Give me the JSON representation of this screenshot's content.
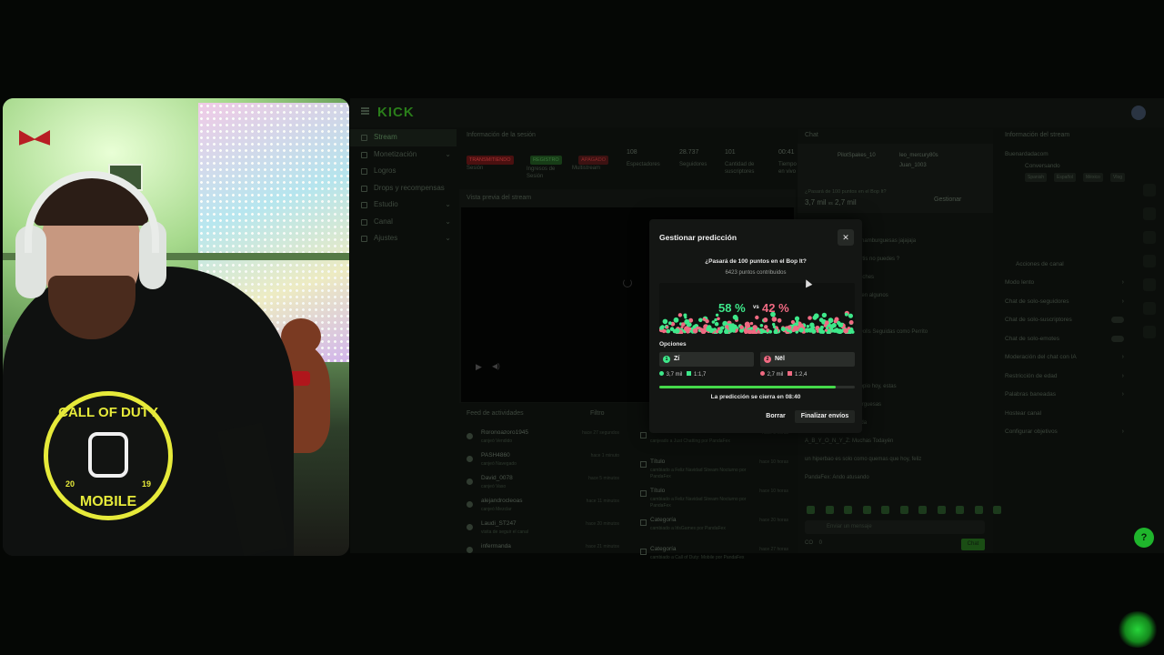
{
  "dashboard": {
    "logo": "KICK",
    "nav": [
      {
        "label": "Stream",
        "active": true,
        "chevron": false
      },
      {
        "label": "Monetización",
        "active": false,
        "chevron": true
      },
      {
        "label": "Logros",
        "active": false,
        "chevron": false
      },
      {
        "label": "Drops y recompensas",
        "active": false,
        "chevron": false
      },
      {
        "label": "Estudio",
        "active": false,
        "chevron": true
      },
      {
        "label": "Canal",
        "active": false,
        "chevron": true
      },
      {
        "label": "Ajustes",
        "active": false,
        "chevron": true
      }
    ],
    "session": {
      "title": "Información de la sesión",
      "status_badges": [
        "TRANSMITIENDO",
        "REGISTRO",
        "APAGADO"
      ],
      "status_labels": [
        "Sesión",
        "Ingresos de Sesión",
        "Multistream"
      ],
      "stats": [
        {
          "value": "108",
          "label": "Espectadores"
        },
        {
          "value": "28.737",
          "label": "Seguidores"
        },
        {
          "value": "101",
          "label": "Cantidad de suscriptores"
        },
        {
          "value": "00:41",
          "label": "Tiempo en vivo"
        }
      ]
    },
    "preview": {
      "title": "Vista previa del stream"
    },
    "feed": {
      "title": "Feed de actividades",
      "filter_label": "Filtro",
      "rows": [
        {
          "name": "Roronoazoro1945",
          "sub": "canjeó Vendido",
          "time": "hace 27 segundos"
        },
        {
          "name": "PASH4860",
          "sub": "canjeó Navegado",
          "time": "hace 1 minuto"
        },
        {
          "name": "David_0078",
          "sub": "canjeó Vaso",
          "time": "hace 5 minutos"
        },
        {
          "name": "alejandrocleoas",
          "sub": "canjeó Mezclar",
          "time": "hace 11 minutos"
        },
        {
          "name": "Laudi_ST247",
          "sub": "visita de seguir el canal",
          "time": "hace 20 minutos"
        },
        {
          "name": "inferrnanda",
          "sub": "",
          "time": "hace 21 minutos"
        }
      ]
    },
    "activity": {
      "rows": [
        {
          "title": "",
          "sub": "canjeado a Just Chatting por PandaFex",
          "time": "hace 3 horas"
        },
        {
          "title": "Título",
          "sub": "cambiado a Feliz Navidad Stream Nocturno por PandaFex",
          "time": "hace 10 horas"
        },
        {
          "title": "Título",
          "sub": "cambiado a Feliz Navidad Stream Nocturno por PandaFex",
          "time": "hace 10 horas"
        },
        {
          "title": "Categoría",
          "sub": "cambiado a IrlsGames por PandaFex",
          "time": "hace 20 horas"
        },
        {
          "title": "Categoría",
          "sub": "cambiado a Call of Duty: Mobile por PandaFex",
          "time": "hace 27 horas"
        }
      ]
    },
    "chat": {
      "title": "Chat",
      "pinned_users": [
        "PilotSpakes_10",
        "leo_mercury80s",
        "Juan_1003"
      ],
      "prediction_question": "¿Pasará de 100 puntos en el Bop It?",
      "prediction_votes_a": "3,7 mil",
      "prediction_vs": "vs",
      "prediction_votes_b": "2,7 mil",
      "manage_label": "Gestionar",
      "lines": [
        "¿como estas lokaso?",
        "de nadie movados con hamburguesas jajajaja",
        "de mamás sobre o abortis no puedes ?",
        "bajo saludos buenas noches",
        "Gracias al Bop It juego en algunos",
        "coco",
        "Aunque se extra, Bop Dolls Seguidas como Perrito",
        "ana mo fallan solas",
        "ocoooo",
        "lo ve la cara mas de propio hoy, estas",
        "comen gatos no hamburguesas",
        "estaba bueno por la onda",
        "A_B_Y_O_N_Y_Z: Muchas Todayén",
        "un hiperbao es solo como quemas que hoy, feliz",
        "PandaFex: Ando atusando"
      ],
      "input_placeholder": "Enviar un mensaje",
      "bottom_count_a": "CO",
      "bottom_count_b": "0",
      "send_label": "Chat"
    },
    "stream_info": {
      "title": "Información del stream",
      "streamer": "Buenardadacom",
      "category": "Conversando",
      "tags": [
        "Spanish",
        "Español",
        "México",
        "Vlog"
      ],
      "channel_actions_title": "Acciones de canal",
      "settings": [
        {
          "label": "Modo lento",
          "kind": "chevron"
        },
        {
          "label": "Chat de solo-seguidores",
          "kind": "chevron"
        },
        {
          "label": "Chat de solo-suscriptores",
          "kind": "toggle"
        },
        {
          "label": "Chat de solo-emotes",
          "kind": "toggle"
        },
        {
          "label": "Moderación del chat con IA",
          "kind": "chevron"
        },
        {
          "label": "Restricción de edad",
          "kind": "chevron"
        },
        {
          "label": "Palabras baneadas",
          "kind": "chevron"
        },
        {
          "label": "Hostear canal",
          "kind": "none"
        },
        {
          "label": "Configurar objetivos",
          "kind": "chevron"
        }
      ]
    }
  },
  "modal": {
    "title": "Gestionar predicción",
    "question": "¿Pasará de 100 puntos en el Bop It?",
    "points": "6423 puntos contribuidos",
    "pct_a": "58 %",
    "vs": "vs",
    "pct_b": "42 %",
    "share_a": 0.58,
    "options_label": "Opciones",
    "options": [
      {
        "marker": "1",
        "label": "Zí",
        "votes": "3,7 mil",
        "ratio": "1:1,7",
        "color": "#3ee88a"
      },
      {
        "marker": "2",
        "label": "Nël",
        "votes": "2,7 mil",
        "ratio": "1:2,4",
        "color": "#f06a82"
      }
    ],
    "timer_progress": 0.9,
    "closes_text": "La predicción se cierra en 08:40",
    "delete_label": "Borrar",
    "finish_label": "Finalizar envíos",
    "close_glyph": "✕"
  },
  "webcam": {
    "shirt_top": "CALL OF DUTY",
    "shirt_bottom": "MOBILE",
    "shirt_year_a": "20",
    "shirt_year_b": "19"
  },
  "colors": {
    "accent": "#45d94a",
    "yes": "#3ee88a",
    "no": "#f06a82"
  }
}
